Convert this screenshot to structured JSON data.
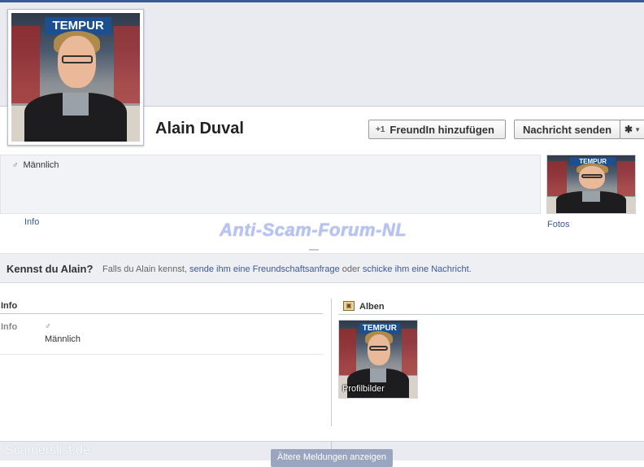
{
  "profile": {
    "name": "Alain Duval",
    "photo_sign_text": "TEMPUR",
    "gender": "Männlich"
  },
  "actions": {
    "add_friend_label": "FreundIn hinzufügen",
    "add_friend_icon": "+1",
    "send_message_label": "Nachricht senden",
    "gear_icon": "gear-icon"
  },
  "tabs": {
    "info": "Info",
    "fotos": "Fotos"
  },
  "watermark": "Anti-Scam-Forum-NL",
  "kennst": {
    "title": "Kennst du Alain?",
    "text_before": "Falls du Alain kennst,",
    "link1": "sende ihm eine Freundschaftsanfrage",
    "text_middle": "oder",
    "link2": "schicke ihm eine Nachricht",
    "text_after": "."
  },
  "info_section": {
    "heading": "Info",
    "label": "Info",
    "value": "Männlich"
  },
  "alben_section": {
    "heading": "Alben",
    "album_label": "Profilbilder"
  },
  "footer": {
    "watermark": "Scamerslist.de",
    "older_button": "Ältere Meldungen anzeigen"
  },
  "colors": {
    "brand": "#3b5998",
    "cover": "#e9ebf1"
  }
}
